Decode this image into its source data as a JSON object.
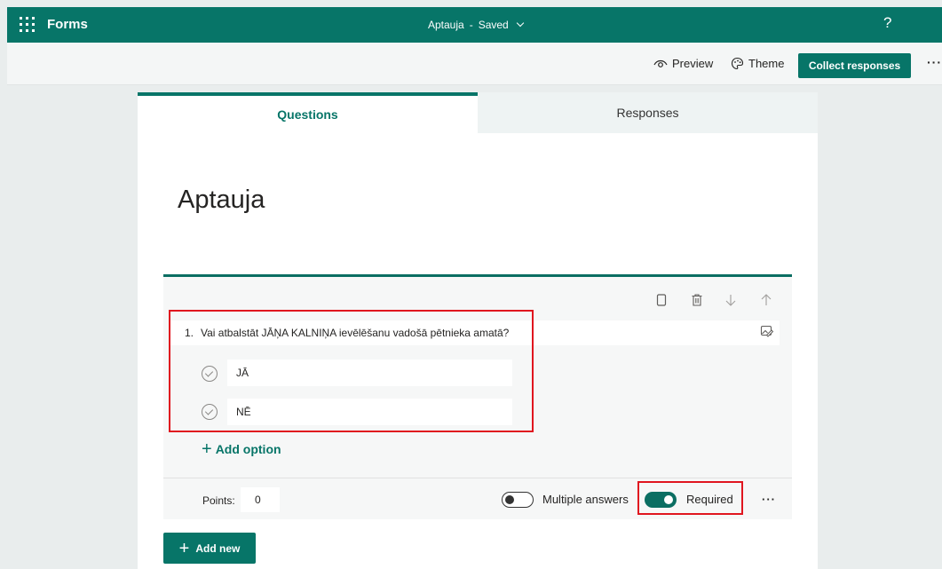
{
  "topbar": {
    "app_name": "Forms",
    "doc_title": "Aptauja",
    "separator": "-",
    "save_status": "Saved",
    "help": "?"
  },
  "cmdbar": {
    "preview_label": "Preview",
    "theme_label": "Theme",
    "collect_label": "Collect responses",
    "more": "···"
  },
  "tabs": [
    {
      "label": "Questions",
      "selected": true
    },
    {
      "label": "Responses",
      "selected": false
    }
  ],
  "form": {
    "title": "Aptauja"
  },
  "question": {
    "number": "1.",
    "text": "Vai atbalstāt JĀŅA KALNIŅA ievēlēšanu vadošā pētnieka amatā?",
    "options": [
      "JĀ",
      "NĒ"
    ],
    "add_option_label": "Add option",
    "points_label": "Points:",
    "points_value": "0",
    "multiple_answers_label": "Multiple answers",
    "multiple_answers_on": false,
    "required_label": "Required",
    "required_on": true,
    "more": "···"
  },
  "add_new_label": "Add new",
  "colors": {
    "accent": "#077568",
    "highlight": "#e0161f"
  }
}
